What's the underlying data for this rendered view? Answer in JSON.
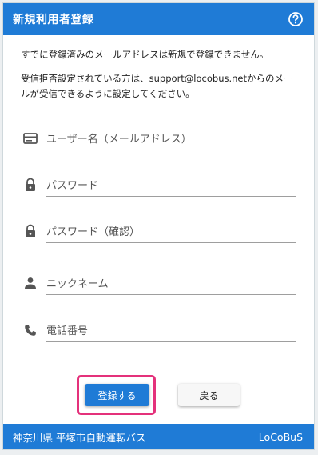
{
  "header": {
    "title": "新規利用者登録",
    "help_icon": "help-circle-icon"
  },
  "notice": {
    "line1": "すでに登録済みのメールアドレスは新規で登録できません。",
    "line2": "受信拒否設定されている方は、support@locobus.netからのメールが受信できるように設定してください。"
  },
  "fields": {
    "username": {
      "placeholder": "ユーザー名（メールアドレス）",
      "icon": "card-icon"
    },
    "password": {
      "placeholder": "パスワード",
      "icon": "lock-icon"
    },
    "password_confirm": {
      "placeholder": "パスワード（確認）",
      "icon": "lock-icon"
    },
    "nickname": {
      "placeholder": "ニックネーム",
      "icon": "person-icon"
    },
    "phone": {
      "placeholder": "電話番号",
      "icon": "phone-icon"
    }
  },
  "buttons": {
    "register": "登録する",
    "back": "戻る"
  },
  "footer": {
    "left": "神奈川県 平塚市自動運転バス",
    "right": "LoCoBuS"
  },
  "colors": {
    "primary": "#1f7bd6",
    "highlight": "#e4317b"
  }
}
